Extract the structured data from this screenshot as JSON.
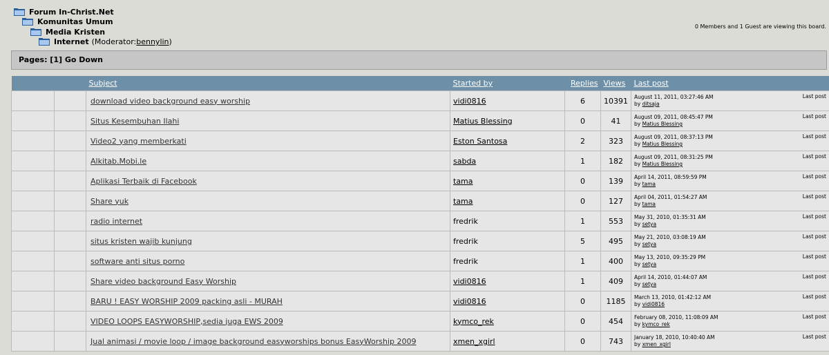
{
  "breadcrumb": [
    {
      "label": "Forum In-Christ.Net"
    },
    {
      "label": "Komunitas Umum"
    },
    {
      "label": "Media Kristen"
    },
    {
      "label": "Internet",
      "suffix_pre": "(Moderator: ",
      "link": "bennylin",
      "suffix_post": ")"
    }
  ],
  "viewing": "0 Members and 1 Guest are viewing this board.",
  "pages_bar": "Pages: [1] Go Down",
  "columns": {
    "subject": "Subject",
    "started_by": "Started by",
    "replies": "Replies",
    "views": "Views",
    "last_post": "Last post"
  },
  "topics": [
    {
      "subject": "download video background easy worship",
      "starter": "vidi0816",
      "starter_link": true,
      "replies": "6",
      "views": "10391",
      "last_date": "August 11, 2011, 03:27:46 AM",
      "last_by": "ditsaja",
      "last_label": "Last post"
    },
    {
      "subject": "Situs Kesembuhan Ilahi",
      "starter": "Matius Blessing",
      "starter_link": true,
      "replies": "0",
      "views": "41",
      "last_date": "August 09, 2011, 08:45:47 PM",
      "last_by": "Matius Blessing",
      "last_label": "Last post"
    },
    {
      "subject": "Video2 yang memberkati",
      "starter": "Eston Santosa",
      "starter_link": true,
      "replies": "2",
      "views": "323",
      "last_date": "August 09, 2011, 08:37:13 PM",
      "last_by": "Matius Blessing",
      "last_label": "Last post"
    },
    {
      "subject": "Alkitab.Mobi.le",
      "starter": "sabda",
      "starter_link": true,
      "replies": "1",
      "views": "182",
      "last_date": "August 09, 2011, 08:31:25 PM",
      "last_by": "Matius Blessing",
      "last_label": "Last post"
    },
    {
      "subject": "Aplikasi Terbaik di Facebook",
      "starter": "tama",
      "starter_link": true,
      "replies": "0",
      "views": "139",
      "last_date": "April 14, 2011, 08:59:59 PM",
      "last_by": "tama",
      "last_label": "Last post"
    },
    {
      "subject": "Share yuk",
      "starter": "tama",
      "starter_link": true,
      "replies": "0",
      "views": "127",
      "last_date": "April 04, 2011, 01:54:27 AM",
      "last_by": "tama",
      "last_label": "Last post"
    },
    {
      "subject": "radio internet",
      "starter": "fredrik",
      "starter_link": false,
      "replies": "1",
      "views": "553",
      "last_date": "May 31, 2010, 01:35:31 AM",
      "last_by": "setya",
      "last_label": "Last post"
    },
    {
      "subject": "situs kristen wajib kunjung",
      "starter": "fredrik",
      "starter_link": false,
      "replies": "5",
      "views": "495",
      "last_date": "May 21, 2010, 03:08:19 AM",
      "last_by": "setya",
      "last_label": "Last post"
    },
    {
      "subject": "software anti situs porno",
      "starter": "fredrik",
      "starter_link": false,
      "replies": "1",
      "views": "400",
      "last_date": "May 13, 2010, 09:35:29 PM",
      "last_by": "setya",
      "last_label": "Last post"
    },
    {
      "subject": "Share video background Easy Worship",
      "starter": "vidi0816",
      "starter_link": true,
      "replies": "1",
      "views": "409",
      "last_date": "April 14, 2010, 01:44:07 AM",
      "last_by": "setya",
      "last_label": "Last post"
    },
    {
      "subject": "BARU ! EASY WORSHIP 2009 packing asli - MURAH",
      "starter": "vidi0816",
      "starter_link": true,
      "replies": "0",
      "views": "1185",
      "last_date": "March 13, 2010, 01:42:12 AM",
      "last_by": "vidi0816",
      "last_label": "Last post"
    },
    {
      "subject": "VIDEO LOOPS EASYWORSHIP,sedia juga EWS 2009",
      "starter": "kymco_rek",
      "starter_link": true,
      "replies": "0",
      "views": "454",
      "last_date": "February 08, 2010, 11:08:09 AM",
      "last_by": "kymco_rek",
      "last_label": "Last post"
    },
    {
      "subject": "Jual animasi / movie loop / image background easyworships bonus EasyWorship 2009",
      "starter": "xmen_xgirl",
      "starter_link": true,
      "replies": "0",
      "views": "743",
      "last_date": "January 18, 2010, 10:40:40 AM",
      "last_by": "xmen_xgirl",
      "last_label": "Last post"
    }
  ]
}
